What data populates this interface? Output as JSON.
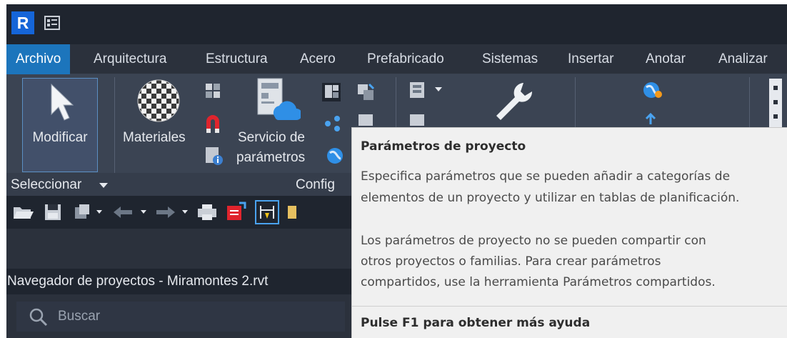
{
  "app": {
    "logo_letter": "R",
    "accent_color": "#1c75bc"
  },
  "tabs": [
    {
      "label": "Archivo",
      "active": true
    },
    {
      "label": "Arquitectura"
    },
    {
      "label": "Estructura"
    },
    {
      "label": "Acero"
    },
    {
      "label": "Prefabricado"
    },
    {
      "label": "Sistemas"
    },
    {
      "label": "Insertar"
    },
    {
      "label": "Anotar"
    },
    {
      "label": "Analizar"
    }
  ],
  "ribbon": {
    "modificar_label": "Modificar",
    "materiales_label": "Materiales",
    "servicio_line1": "Servicio de",
    "servicio_line2": "parámetros",
    "panel_seleccionar": "Seleccionar",
    "panel_config": "Config"
  },
  "project_browser": {
    "title": "Navegador de proyectos - Miramontes 2.rvt",
    "search_placeholder": "Buscar"
  },
  "tooltip": {
    "title": "Parámetros de proyecto",
    "para1_line1": "Especifica parámetros que se pueden añadir a categorías de",
    "para1_line2": "elementos de un proyecto y utilizar en tablas de planificación.",
    "para2_line1": "Los parámetros de proyecto no se pueden compartir con",
    "para2_line2": "otros proyectos o familias. Para crear parámetros",
    "para2_line3": "compartidos, use la herramienta Parámetros compartidos.",
    "help": "Pulse F1 para obtener más ayuda"
  }
}
